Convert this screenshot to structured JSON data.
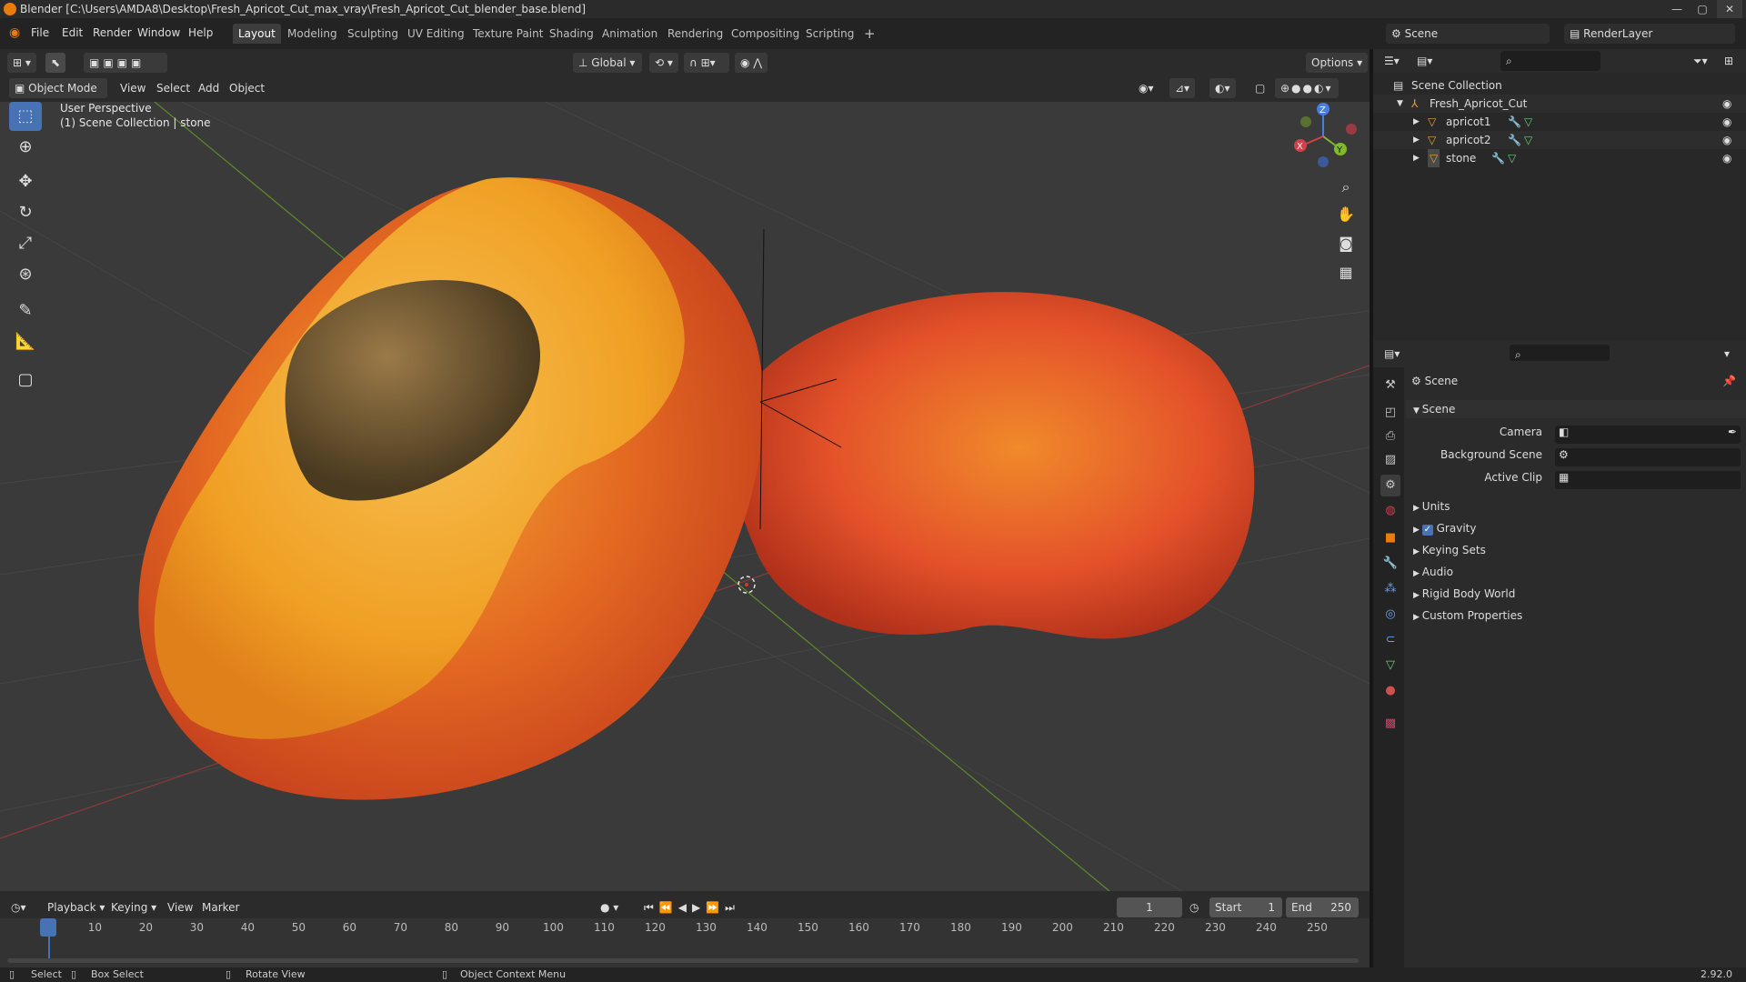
{
  "window": {
    "title": "Blender [C:\\Users\\AMDA8\\Desktop\\Fresh_Apricot_Cut_max_vray\\Fresh_Apricot_Cut_blender_base.blend]",
    "minimize": "—",
    "maximize": "▢",
    "close": "✕"
  },
  "menu": {
    "items": [
      "File",
      "Edit",
      "Render",
      "Window",
      "Help"
    ]
  },
  "workspaces": {
    "tabs": [
      "Layout",
      "Modeling",
      "Sculpting",
      "UV Editing",
      "Texture Paint",
      "Shading",
      "Animation",
      "Rendering",
      "Compositing",
      "Scripting"
    ],
    "add": "+",
    "active": "Layout"
  },
  "scene": {
    "name": "Scene",
    "view_layer": "RenderLayer"
  },
  "viewport_header": {
    "transform_orientation": "Global",
    "options": "Options",
    "mode": "Object Mode",
    "menus": [
      "View",
      "Select",
      "Add",
      "Object"
    ]
  },
  "viewport": {
    "perspective": "User Perspective",
    "collection_info": "(1) Scene Collection | stone",
    "gizmo": {
      "z": "Z",
      "y": "Y",
      "x": "X"
    }
  },
  "outliner": {
    "root": "Scene Collection",
    "collection": "Fresh_Apricot_Cut",
    "objects": [
      "apricot1",
      "apricot2",
      "stone"
    ],
    "search_icon": "magnifier-icon"
  },
  "properties": {
    "context": "Scene",
    "panel": "Scene",
    "fields": [
      {
        "label": "Camera"
      },
      {
        "label": "Background Scene"
      },
      {
        "label": "Active Clip"
      }
    ],
    "sections": [
      "Units",
      "Gravity",
      "Keying Sets",
      "Audio",
      "Rigid Body World",
      "Custom Properties"
    ],
    "gravity_checked": true
  },
  "timeline": {
    "menus": [
      "Playback",
      "Keying",
      "View",
      "Marker"
    ],
    "current_frame": "1",
    "start_label": "Start",
    "start": "1",
    "end_label": "End",
    "end": "250",
    "ticks": [
      "1",
      "10",
      "20",
      "30",
      "40",
      "50",
      "60",
      "70",
      "80",
      "90",
      "100",
      "110",
      "120",
      "130",
      "140",
      "150",
      "160",
      "170",
      "180",
      "190",
      "200",
      "210",
      "220",
      "230",
      "240",
      "250"
    ]
  },
  "status": {
    "select": "Select",
    "box_select": "Box Select",
    "rotate_view": "Rotate View",
    "context_menu": "Object Context Menu",
    "version": "2.92.0"
  },
  "colors": {
    "accent": "#4772b3",
    "blender_orange": "#e87d0d",
    "x_axis": "#d0424b",
    "y_axis": "#7fba2a",
    "z_axis": "#4a7be0"
  }
}
